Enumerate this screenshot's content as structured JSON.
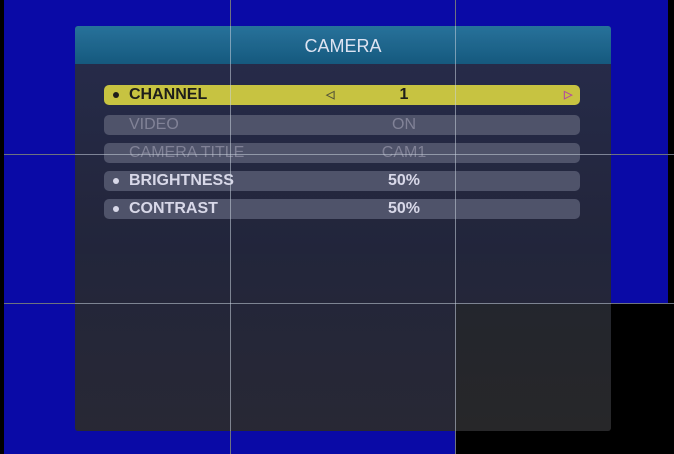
{
  "menu": {
    "title": "CAMERA",
    "items": [
      {
        "label": "CHANNEL",
        "value": "1",
        "left_arrow": "◁",
        "right_arrow": "▷",
        "state": "selected"
      },
      {
        "label": "VIDEO",
        "value": "ON",
        "state": "disabled"
      },
      {
        "label": "CAMERA TITLE",
        "value": "CAM1",
        "state": "disabled"
      },
      {
        "label": "BRIGHTNESS",
        "value": "50%",
        "state": "enabled"
      },
      {
        "label": "CONTRAST",
        "value": "50%",
        "state": "enabled"
      }
    ]
  },
  "colors": {
    "camera_feed_bg": "#0a0aa6",
    "header_bg": "#1b6a88",
    "selected_row": "#d6d23a",
    "row_bg": "#555966"
  }
}
